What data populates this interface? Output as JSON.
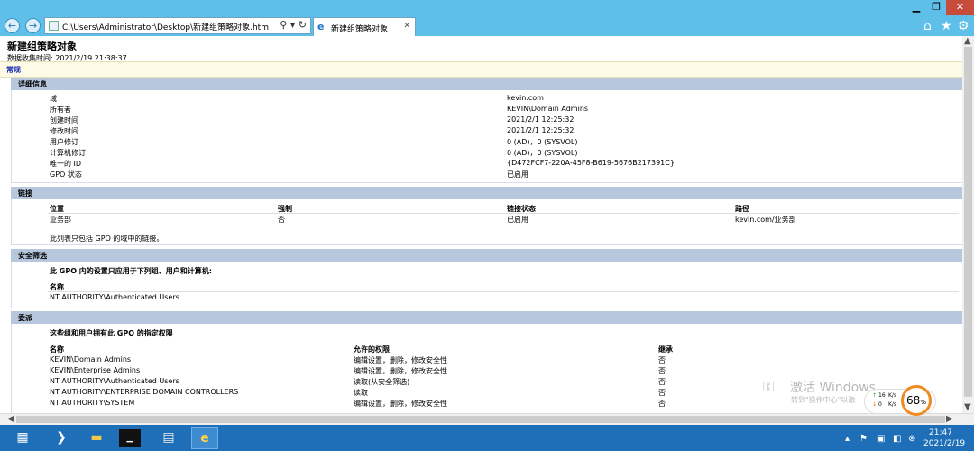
{
  "browser": {
    "address": "C:\\Users\\Administrator\\Desktop\\新建组策略对象.htm",
    "tab_title": "新建组策略对象",
    "close_tab": "✕"
  },
  "report": {
    "title": "新建组策略对象",
    "collected": "数据收集时间: 2021/2/19 21:38:37",
    "general_link": "常规"
  },
  "details": {
    "header": "详细信息",
    "rows": [
      {
        "label": "域",
        "value": "kevin.com"
      },
      {
        "label": "所有者",
        "value": "KEVIN\\Domain Admins"
      },
      {
        "label": "创建时间",
        "value": "2021/2/1 12:25:32"
      },
      {
        "label": "修改时间",
        "value": "2021/2/1 12:25:32"
      },
      {
        "label": "用户修订",
        "value": "0 (AD)，0 (SYSVOL)"
      },
      {
        "label": "计算机修订",
        "value": "0 (AD)，0 (SYSVOL)"
      },
      {
        "label": "唯一的 ID",
        "value": "{D472FCF7-220A-45F8-B619-5676B217391C}"
      },
      {
        "label": "GPO 状态",
        "value": "已启用"
      }
    ]
  },
  "links": {
    "header": "链接",
    "columns": [
      "位置",
      "强制",
      "链接状态",
      "路径"
    ],
    "rows": [
      [
        "业务部",
        "否",
        "已启用",
        "kevin.com/业务部"
      ]
    ],
    "note": "此列表只包括 GPO 的域中的链接。"
  },
  "security": {
    "header": "安全筛选",
    "intro": "此 GPO 内的设置只应用于下列组、用户和计算机:",
    "column": "名称",
    "rows": [
      "NT AUTHORITY\\Authenticated Users"
    ]
  },
  "delegation": {
    "header": "委派",
    "intro": "这些组和用户拥有此 GPO 的指定权限",
    "columns": [
      "名称",
      "允许的权限",
      "继承"
    ],
    "rows": [
      [
        "KEVIN\\Domain Admins",
        "编辑设置，删除，修改安全性",
        "否"
      ],
      [
        "KEVIN\\Enterprise Admins",
        "编辑设置，删除，修改安全性",
        "否"
      ],
      [
        "NT AUTHORITY\\Authenticated Users",
        "读取(从安全筛选)",
        "否"
      ],
      [
        "NT AUTHORITY\\ENTERPRISE DOMAIN CONTROLLERS",
        "读取",
        "否"
      ],
      [
        "NT AUTHORITY\\SYSTEM",
        "编辑设置，删除，修改安全性",
        "否"
      ]
    ]
  },
  "watermark": {
    "line1": "激活 Windows",
    "line2": "转到\"操作中心\"以激"
  },
  "netwidget": {
    "up": "16",
    "down": "0",
    "unit": "K/s",
    "percent": "68",
    "percent_suffix": "%"
  },
  "clock": {
    "time": "21:47",
    "date": "2021/2/19"
  },
  "colors": {
    "titlebar": "#5ec0e9",
    "taskbar": "#1e6fb8",
    "section_header": "#b7c7dd",
    "general_link": "#1b2fb4",
    "gauge": "#f08a20"
  }
}
